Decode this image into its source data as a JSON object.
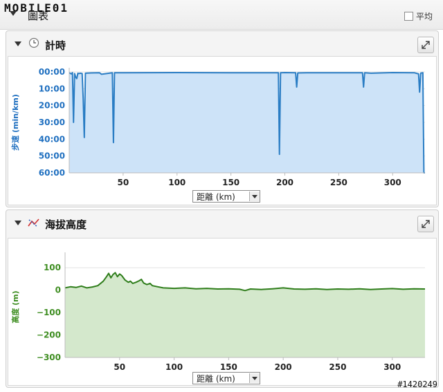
{
  "header": {
    "logo_text": "MOBILE01",
    "title": "圖表",
    "average_label": "平均"
  },
  "panels": [
    {
      "title": "計時",
      "icon": "clock-icon"
    },
    {
      "title": "海拔高度",
      "icon": "elevation-icon"
    }
  ],
  "selector": {
    "value": "距離 (km)"
  },
  "watermark": "#1420249",
  "colors": {
    "pace_line": "#2a7dc4",
    "pace_fill": "#cde3f8",
    "pace_axis_text": "#2070c0",
    "elev_line": "#2e7d1a",
    "elev_fill": "#d4e8cc",
    "elev_axis_text": "#3f8e22"
  },
  "chart_data": [
    {
      "type": "area",
      "name": "pace",
      "ylabel": "步速 (min/km)",
      "xlabel": "",
      "xlim": [
        0,
        330
      ],
      "ylim": [
        0,
        60
      ],
      "y_inverted": true,
      "x_ticks": [
        "50",
        "100",
        "150",
        "200",
        "250",
        "300"
      ],
      "y_ticks": [
        "00:00",
        "10:00",
        "20:00",
        "30:00",
        "40:00",
        "50:00",
        "60:00"
      ],
      "grid": true,
      "legend": "none",
      "x": [
        0,
        2,
        3,
        4,
        5,
        6,
        7,
        8,
        9,
        10,
        12,
        13,
        14,
        15,
        20,
        28,
        30,
        40,
        41,
        42,
        50,
        100,
        150,
        194,
        195,
        196,
        200,
        210,
        211,
        212,
        220,
        250,
        272,
        273,
        274,
        280,
        300,
        320,
        324,
        325,
        326,
        328,
        329,
        330
      ],
      "y": [
        0.5,
        1.2,
        0.4,
        30,
        1,
        3,
        4,
        0.8,
        1.0,
        0.8,
        1.0,
        16,
        39,
        0.8,
        0.6,
        0.5,
        1.4,
        0.5,
        42,
        0.5,
        0.5,
        0.4,
        0.5,
        0.5,
        49,
        0.5,
        0.4,
        0.5,
        9,
        0.6,
        0.5,
        0.5,
        0.5,
        9,
        0.5,
        0.8,
        0.4,
        0.5,
        1.2,
        12,
        0.8,
        0.5,
        60,
        60
      ]
    },
    {
      "type": "area",
      "name": "elevation",
      "ylabel": "高度 (m)",
      "xlabel": "",
      "xlim": [
        0,
        330
      ],
      "ylim": [
        -300,
        150
      ],
      "x_ticks": [
        "50",
        "100",
        "150",
        "200",
        "250",
        "300"
      ],
      "y_ticks": [
        "100",
        "0",
        "−100",
        "−200",
        "−300"
      ],
      "grid": true,
      "legend": "none",
      "x": [
        0,
        5,
        10,
        15,
        20,
        25,
        30,
        35,
        38,
        40,
        42,
        44,
        46,
        48,
        50,
        52,
        55,
        58,
        60,
        62,
        65,
        68,
        70,
        72,
        75,
        78,
        80,
        85,
        90,
        100,
        110,
        120,
        130,
        140,
        150,
        160,
        165,
        170,
        180,
        190,
        200,
        210,
        220,
        230,
        240,
        250,
        260,
        270,
        280,
        290,
        300,
        310,
        320,
        330
      ],
      "y": [
        10,
        15,
        12,
        18,
        10,
        14,
        20,
        40,
        60,
        75,
        55,
        70,
        78,
        60,
        72,
        65,
        45,
        35,
        40,
        30,
        35,
        42,
        48,
        32,
        25,
        30,
        20,
        15,
        10,
        8,
        10,
        6,
        8,
        5,
        6,
        4,
        -2,
        5,
        3,
        6,
        10,
        5,
        4,
        6,
        3,
        5,
        4,
        6,
        3,
        5,
        7,
        4,
        6,
        5
      ]
    }
  ]
}
